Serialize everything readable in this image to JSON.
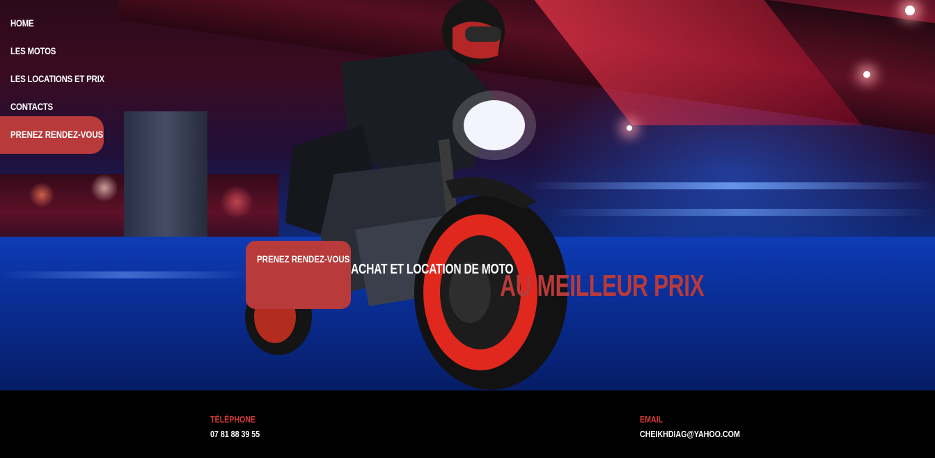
{
  "nav": {
    "items": [
      {
        "label": "HOME"
      },
      {
        "label": "LES MOTOS"
      },
      {
        "label": "LES LOCATIONS ET PRIX"
      },
      {
        "label": "CONTACTS"
      }
    ],
    "cta_label": "PRENEZ RENDEZ-VOUS"
  },
  "hero": {
    "cta_label": "PRENEZ RENDEZ-VOUS",
    "tagline": "ACHAT ET LOCATION DE MOTO",
    "tagline_accent": "AU MEILLEUR PRIX",
    "image": "motorcycle-rider-night-highway"
  },
  "footer": {
    "phone_label": "TÉLÉPHONE",
    "phone_value": "07 81 88 39 55",
    "email_label": "EMAIL",
    "email_value": "CHEIKHDIAG@YAHOO.COM"
  },
  "colors": {
    "accent": "#b83a3a",
    "footer_label": "#d23a3a",
    "footer_bg": "#000000",
    "text": "#ffffff"
  }
}
